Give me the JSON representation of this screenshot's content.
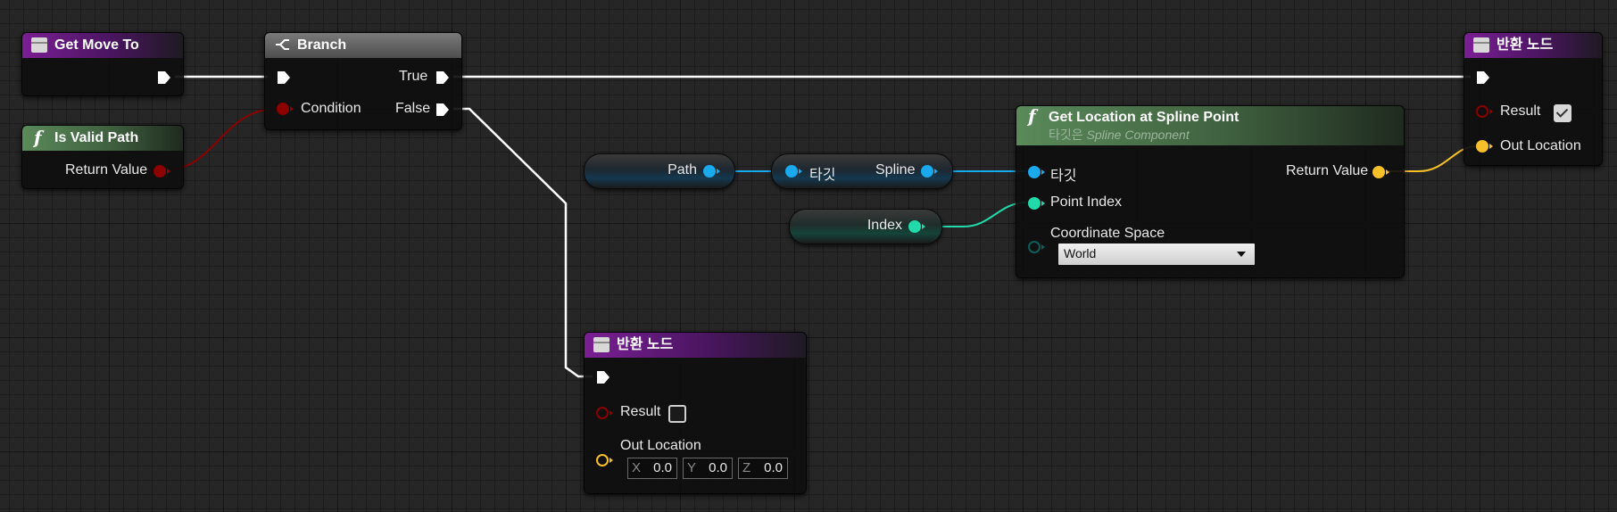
{
  "nodes": {
    "get_move_to": {
      "title": "Get Move To"
    },
    "branch": {
      "title": "Branch",
      "condition": "Condition",
      "true_label": "True",
      "false_label": "False"
    },
    "is_valid_path": {
      "title": "Is Valid Path",
      "return_value": "Return Value"
    },
    "return_top": {
      "title": "반환 노드",
      "result": "Result",
      "result_checked": true,
      "out_location": "Out Location"
    },
    "get_location": {
      "title": "Get Location at Spline Point",
      "subtitle_prefix": "타깃은 ",
      "subtitle_class": "Spline Component",
      "target": "타깃",
      "point_index": "Point Index",
      "coordinate_space": "Coordinate Space",
      "coordinate_value": "World",
      "return_value": "Return Value"
    },
    "return_bottom": {
      "title": "반환 노드",
      "result": "Result",
      "result_checked": false,
      "out_location": "Out Location",
      "x_label": "X",
      "x_value": "0.0",
      "y_label": "Y",
      "y_value": "0.0",
      "z_label": "Z",
      "z_value": "0.0"
    },
    "path_var": {
      "label": "Path"
    },
    "index_var": {
      "label": "Index"
    },
    "spline_getter": {
      "target": "타깃",
      "output": "Spline"
    }
  },
  "colors": {
    "exec": "#ffffff",
    "bool": "#8c0000",
    "object": "#1aa9ec",
    "int": "#21d9a9",
    "vector": "#f7c02a",
    "enum": "#0f5c5c"
  }
}
